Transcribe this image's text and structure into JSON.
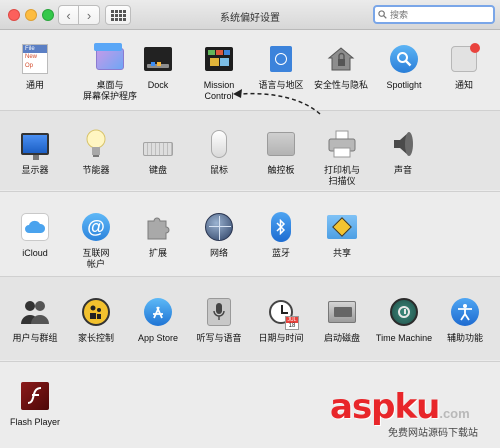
{
  "window": {
    "title": "系统偏好设置",
    "search_placeholder": "搜索"
  },
  "panes": {
    "general": "通用",
    "desktop": "桌面与\n屏幕保护程序",
    "dock": "Dock",
    "mission": "Mission\nControl",
    "language": "语言与地区",
    "security": "安全性与隐私",
    "spotlight": "Spotlight",
    "notifications": "通知",
    "displays": "显示器",
    "energy": "节能器",
    "keyboard": "键盘",
    "mouse": "鼠标",
    "trackpad": "触控板",
    "printers": "打印机与\n扫描仪",
    "sound": "声音",
    "icloud": "iCloud",
    "internet": "互联网\n帐户",
    "extensions": "扩展",
    "network": "网络",
    "bluetooth": "蓝牙",
    "sharing": "共享",
    "users": "用户与群组",
    "parental": "家长控制",
    "appstore": "App Store",
    "dictation": "听写与语音",
    "datetime": "日期与时间",
    "startup": "启动磁盘",
    "timemachine": "Time Machine",
    "accessibility": "辅助功能",
    "flash": "Flash Player"
  },
  "icon_text": {
    "general_file": "File",
    "general_new": "New",
    "general_op": "Op",
    "calendar_month": "JUL",
    "calendar_day": "18"
  },
  "watermark": {
    "main": "aspku",
    "tld": ".com",
    "sub": "免费网站源码下载站"
  },
  "colors": {
    "accent": "#4a8ff2",
    "watermark_red": "#e8262a",
    "notification_dot": "#e9433d"
  }
}
